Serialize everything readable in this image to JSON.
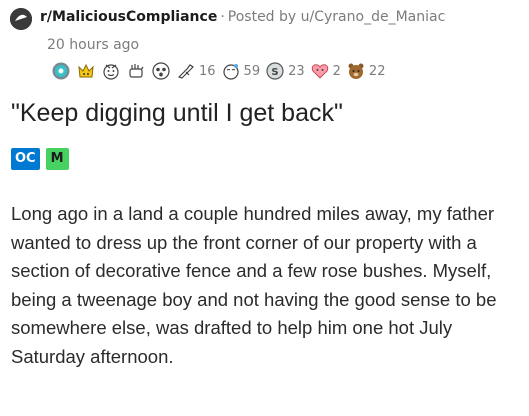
{
  "header": {
    "subreddit": "r/MaliciousCompliance",
    "separator": "·",
    "posted_by": "Posted by u/Cyrano_de_Maniac",
    "time": "20 hours ago"
  },
  "awards": [
    {
      "icon": "helpful-award-icon"
    },
    {
      "icon": "gold-crown-award-icon"
    },
    {
      "icon": "face-award-icon"
    },
    {
      "icon": "hands-award-icon"
    },
    {
      "icon": "surprised-face-award-icon"
    },
    {
      "icon": "pointing-hand-award-icon",
      "count": "16"
    },
    {
      "icon": "kiss-face-award-icon",
      "count": "59"
    },
    {
      "icon": "silver-coin-award-icon",
      "count": "23"
    },
    {
      "icon": "heart-face-award-icon",
      "count": "2"
    },
    {
      "icon": "bear-award-icon",
      "count": "22"
    }
  ],
  "post": {
    "title": "\"Keep digging until I get back\"",
    "flairs": [
      "OC",
      "M"
    ],
    "body": "Long ago in a land a couple hundred miles away, my father wanted to dress up the front corner of our property with a section of decorative fence and a few rose bushes. Myself, being a tweenage boy and not having the good sense to be somewhere else, was drafted to help him one hot July Saturday afternoon."
  },
  "colors": {
    "flair_oc": "#0079d3",
    "flair_m": "#46d160",
    "meta_gray": "#7c7c7c"
  }
}
